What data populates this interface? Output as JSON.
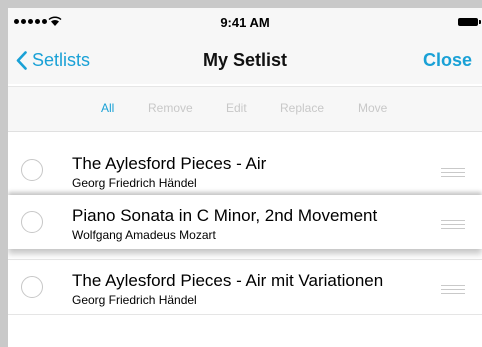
{
  "status_bar": {
    "time": "9:41 AM"
  },
  "nav": {
    "back_label": "Setlists",
    "title": "My Setlist",
    "close_label": "Close"
  },
  "toolbar": {
    "items": [
      "All",
      "Remove",
      "Edit",
      "Replace",
      "Move"
    ],
    "active": "All"
  },
  "list": {
    "items": [
      {
        "title": "The Aylesford Pieces - Air",
        "subtitle": "Georg Friedrich Händel"
      },
      {
        "title": "Piano Sonata in C Minor, 2nd Movement",
        "subtitle": "Wolfgang Amadeus Mozart"
      },
      {
        "title": "The Aylesford Pieces - Air mit Variationen",
        "subtitle": "Georg Friedrich Händel"
      }
    ]
  },
  "colors": {
    "accent": "#1aa1d6",
    "disabled": "#c8c8c8",
    "bar_bg": "#f7f7f7"
  }
}
